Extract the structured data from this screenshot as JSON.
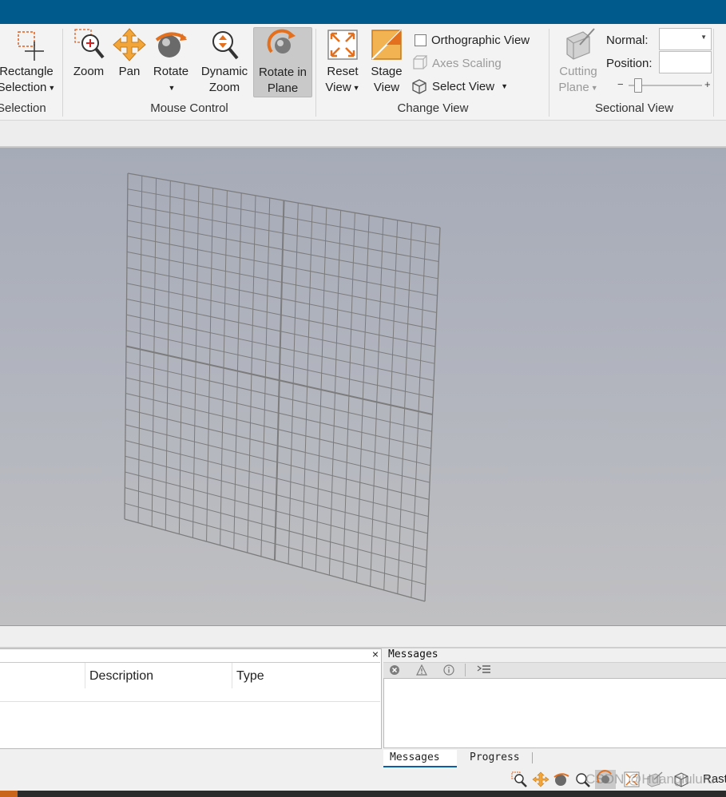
{
  "ribbon": {
    "selection": {
      "label": "Selection",
      "rectangle_line1": "Rectangle",
      "rectangle_line2": "Selection"
    },
    "mouse_control": {
      "label": "Mouse Control",
      "zoom": "Zoom",
      "pan": "Pan",
      "rotate": "Rotate",
      "dynamic_zoom_line1": "Dynamic",
      "dynamic_zoom_line2": "Zoom",
      "rotate_in_plane_line1": "Rotate in",
      "rotate_in_plane_line2": "Plane"
    },
    "change_view": {
      "label": "Change View",
      "reset_view_line1": "Reset",
      "reset_view_line2": "View",
      "stage_view_line1": "Stage",
      "stage_view_line2": "View",
      "orthographic_view": "Orthographic View",
      "axes_scaling": "Axes Scaling",
      "select_view": "Select View"
    },
    "sectional_view": {
      "label": "Sectional View",
      "cutting_plane_line1": "Cutting",
      "cutting_plane_line2": "Plane",
      "normal_label": "Normal:",
      "normal_value": "",
      "position_label": "Position:",
      "position_value": "",
      "slider_minus": "−",
      "slider_plus": "+",
      "slider_fraction": 0.12
    }
  },
  "table_panel": {
    "close": "×",
    "columns": [
      "Description",
      "Type"
    ]
  },
  "messages_panel": {
    "title": "Messages",
    "tabs": [
      "Messages",
      "Progress"
    ],
    "active_tab": "Messages"
  },
  "statusbar": {
    "trailing_text": "Rast",
    "watermark": "CSDN @Huangluluru"
  },
  "colors": {
    "titlebar": "#005a8c",
    "accent_orange": "#f0a030",
    "viewport_top": "#a6abb8",
    "viewport_bottom": "#c0c0c2",
    "mesh_line": "#7c7c7c"
  },
  "icons": [
    "rectangle-selection-icon",
    "zoom-icon",
    "pan-icon",
    "rotate-icon",
    "dynamic-zoom-icon",
    "rotate-in-plane-icon",
    "reset-view-icon",
    "stage-view-icon",
    "axes-scaling-icon",
    "select-view-icon",
    "cutting-plane-icon",
    "error-filter-icon",
    "warning-filter-icon",
    "info-filter-icon",
    "clear-messages-icon"
  ]
}
